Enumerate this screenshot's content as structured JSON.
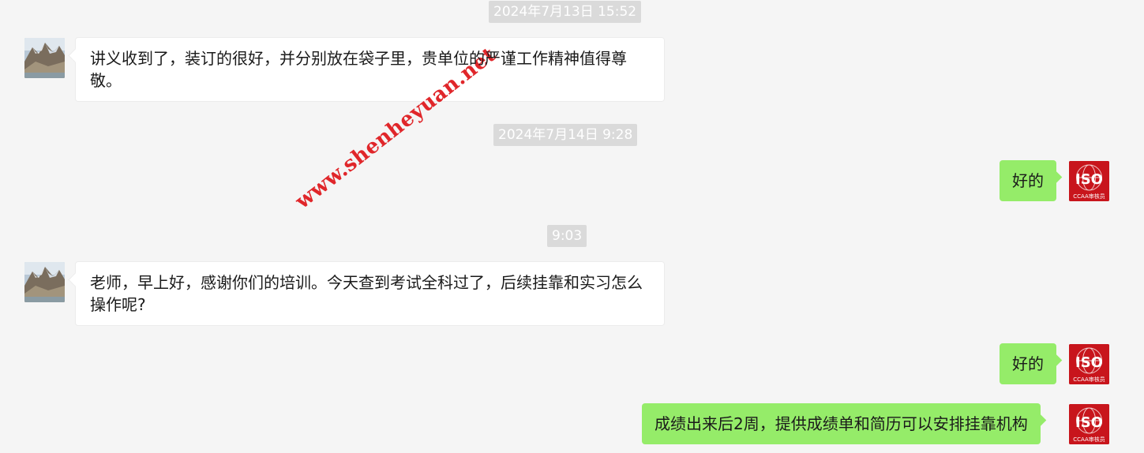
{
  "messages": [
    {
      "kind": "timestamp",
      "text": "2024年7月13日 15:52"
    },
    {
      "kind": "incoming",
      "text": "讲义收到了，装订的很好，并分别放在袋子里，贵单位的严谨工作精神值得尊敬。"
    },
    {
      "kind": "timestamp",
      "text": "2024年7月14日 9:28"
    },
    {
      "kind": "outgoing",
      "text": "好的"
    },
    {
      "kind": "timestamp",
      "text": "9:03"
    },
    {
      "kind": "incoming",
      "text": "老师，早上好，感谢你们的培训。今天查到考试全科过了，后续挂靠和实习怎么操作呢?"
    },
    {
      "kind": "outgoing",
      "text": "好的"
    },
    {
      "kind": "outgoing",
      "text": "成绩出来后2周，提供成绩单和简历可以安排挂靠机构"
    }
  ],
  "avatars": {
    "incoming": "mountain-landscape-avatar",
    "outgoing": {
      "icon": "iso-logo-avatar",
      "logo_text": "ISO",
      "caption": "CCAA审核员"
    }
  },
  "watermark": "www.shenheyuan.net",
  "colors": {
    "background": "#f5f5f5",
    "incoming_bubble": "#ffffff",
    "outgoing_bubble": "#95ec69",
    "timestamp_bg": "#dadada",
    "watermark": "#e0262a",
    "iso_red": "#c8151c"
  }
}
